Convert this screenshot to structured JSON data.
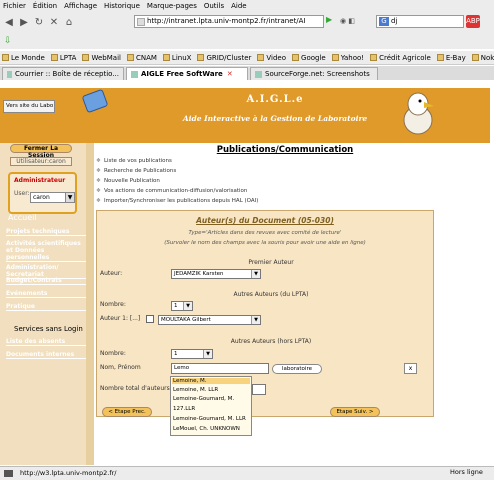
{
  "menu": [
    "Fichier",
    "Édition",
    "Affichage",
    "Historique",
    "Marque-pages",
    "Outils",
    "Aide"
  ],
  "navbar": {
    "url": "http://intranet.lpta.univ-montp2.fr/intranet/AI",
    "search_value": "dj"
  },
  "bookmarks": [
    "Le Monde",
    "LPTA",
    "WebMail",
    "CNAM",
    "LinuX",
    "GRID/Cluster",
    "Video",
    "Google",
    "Yahoo!",
    "Crédit Agricole",
    "E-Bay",
    "Nokia"
  ],
  "tabs": [
    "Courrier :: Boîte de réceptio...",
    "AIGLE Free SoftWare",
    "SourceForge.net: Screenshots"
  ],
  "banner": {
    "left_box": "Vers site du Labo",
    "title": "A.I.G.L.e",
    "subtitle": "Aide Interactive à la Gestion de Laboratoire"
  },
  "sidebar": {
    "session_btn": "Fermer La Session",
    "user_btn": "Utilisateur:caron",
    "admin_label": "Administrateur",
    "user_label": "User:",
    "user_select": "caron",
    "accueil": "Accueil",
    "links": [
      "Projets techniques",
      "Activités scientifiques et Données personnelles",
      "Administration/ Secretariat",
      "Budget/Contrats",
      "Evénements",
      "Pratique"
    ],
    "services": "Services sans Login",
    "links2": [
      "Liste des absents",
      "Documents internes"
    ]
  },
  "main": {
    "title": "Publications/Communication",
    "items": [
      "Liste de vos publications",
      "Recherche de Publications",
      "Nouvelle Publication",
      "Vos actions de communication-diffusion/valorisation",
      "Importer/Synchroniser les publications depuis HAL (OAI)"
    ]
  },
  "form": {
    "title": "Auteur(s) du Document (05-030)",
    "sub1": "Type='Articles dans des revues avec comité de lecture'",
    "sub2": "(Survoler le nom des champs avec la souris pour avoir une aide en ligne)",
    "premier": "Premier Auteur",
    "auteur_lbl": "Auteur:",
    "auteur_val": "JEDAMZIK Karsten",
    "autres_lpta": "Autres Auteurs (du LPTA)",
    "nombre_lbl": "Nombre:",
    "nombre1": "1",
    "auteur1_lbl": "Auteur 1: [...]",
    "auteur1_val": "MOULTAKA Gilbert",
    "autres_hors": "Autres Auteurs (hors LPTA)",
    "nombre2": "1",
    "nomprenom_lbl": "Nom, Prénom",
    "nom_input": "Lemo",
    "labo_btn": "laboratoire",
    "x_btn": "x",
    "total_lbl": "Nombre total d'auteurs (y",
    "prev_btn": "< Etape Prec.",
    "next_btn": "Etape Suiv. >",
    "suggestions": [
      "Lemoine, M.",
      "Lemoine, M. LLR",
      "Lemoine-Goumard, M.",
      "127.LLR",
      "Lemoine-Goumard, M. LLR",
      "LeMouel, Ch. UNKNOWN"
    ]
  },
  "status": {
    "url": "http://w3.lpta.univ-montp2.fr/",
    "right": "Hors ligne"
  }
}
